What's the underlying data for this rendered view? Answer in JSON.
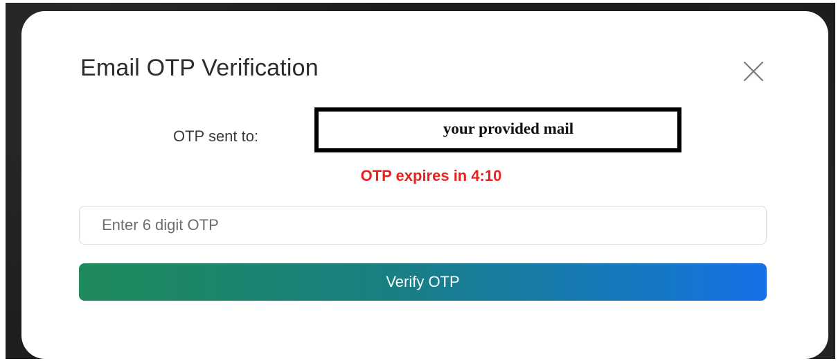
{
  "modal": {
    "title": "Email OTP Verification",
    "close_icon": "close-icon",
    "otp_sent_label": "OTP sent to:",
    "email_value": "your provided mail",
    "expiry_text": "OTP expires in 4:10",
    "otp_input": {
      "value": "",
      "placeholder": "Enter 6 digit OTP"
    },
    "verify_button_label": "Verify OTP"
  },
  "colors": {
    "expiry": "#e8231f",
    "button_gradient_start": "#1f8a5a",
    "button_gradient_end": "#1670e8",
    "title": "#2b2b2b"
  }
}
